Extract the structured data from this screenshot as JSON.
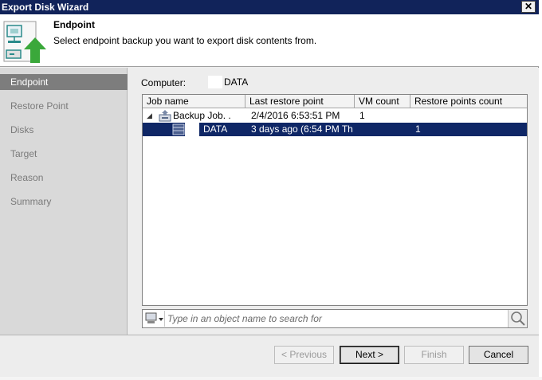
{
  "window": {
    "title": "Export Disk Wizard",
    "close_glyph": "✕"
  },
  "header": {
    "title": "Endpoint",
    "subtitle": "Select endpoint backup you want to export disk contents from."
  },
  "steps": [
    {
      "label": "Endpoint",
      "active": true
    },
    {
      "label": "Restore Point",
      "active": false
    },
    {
      "label": "Disks",
      "active": false
    },
    {
      "label": "Target",
      "active": false
    },
    {
      "label": "Reason",
      "active": false
    },
    {
      "label": "Summary",
      "active": false
    }
  ],
  "computer": {
    "label": "Computer:",
    "value": "DATA"
  },
  "grid": {
    "columns": [
      "Job name",
      "Last restore point",
      "VM count",
      "Restore points count"
    ],
    "rows": [
      {
        "expander": "◢",
        "name": "Backup Job.   .",
        "last_restore": "2/4/2016 6:53:51 PM",
        "vm_count": "1",
        "restore_points": "",
        "selected": false
      },
      {
        "expander": "",
        "name": "DATA",
        "last_restore": "3 days ago (6:54 PM Th...",
        "vm_count": "",
        "restore_points": "1",
        "selected": true
      }
    ]
  },
  "search": {
    "placeholder": "Type in an object name to search for",
    "value": ""
  },
  "buttons": {
    "previous": "< Previous",
    "next": "Next >",
    "finish": "Finish",
    "cancel": "Cancel"
  },
  "colors": {
    "title_bar": "#11235a",
    "selection": "#0f2766",
    "active_step": "#7d7d7d",
    "icon_green": "#3aa83a"
  }
}
